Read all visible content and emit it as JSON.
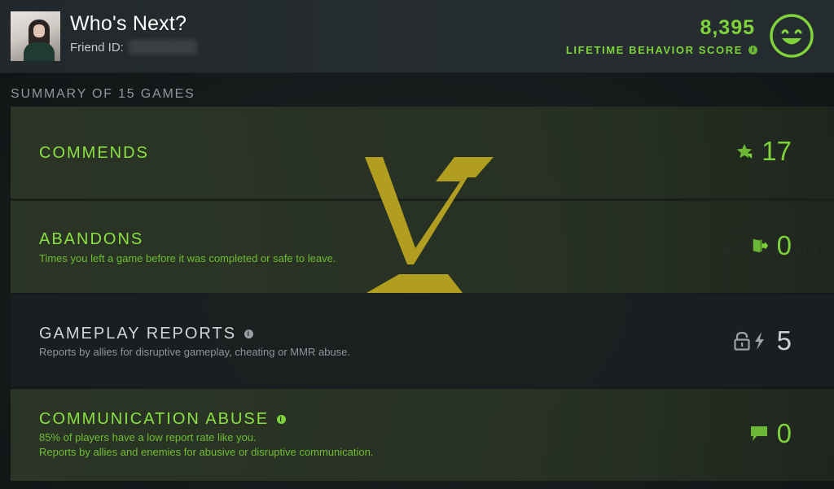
{
  "header": {
    "player_name": "Who's Next?",
    "friend_id_label": "Friend ID:",
    "behavior_score": "8,395",
    "behavior_score_label": "LIFETIME BEHAVIOR SCORE",
    "info_icon": "info-icon",
    "smiley_icon": "smiley-face-icon"
  },
  "summary": {
    "title": "SUMMARY OF 15 GAMES",
    "rows": [
      {
        "title": "COMMENDS",
        "subtitle": "",
        "value": "17",
        "icon": "star-icon"
      },
      {
        "title": "ABANDONS",
        "subtitle": "Times you left a game before it was completed or safe to leave.",
        "value": "0",
        "icon": "exit-door-icon"
      },
      {
        "title": "GAMEPLAY REPORTS",
        "subtitle": "Reports by allies for disruptive gameplay, cheating or MMR abuse.",
        "value": "5",
        "icon": "lock-lightning-icon"
      },
      {
        "title": "COMMUNICATION ABUSE",
        "subtitle": "85% of players have a low report rate like you.",
        "subtitle2": "Reports by allies and enemies for abusive or disruptive communication.",
        "value": "0",
        "icon": "chat-bubble-icon"
      }
    ]
  },
  "colors": {
    "accent_green": "#7ed33a",
    "logo_gold": "#c9b020"
  }
}
